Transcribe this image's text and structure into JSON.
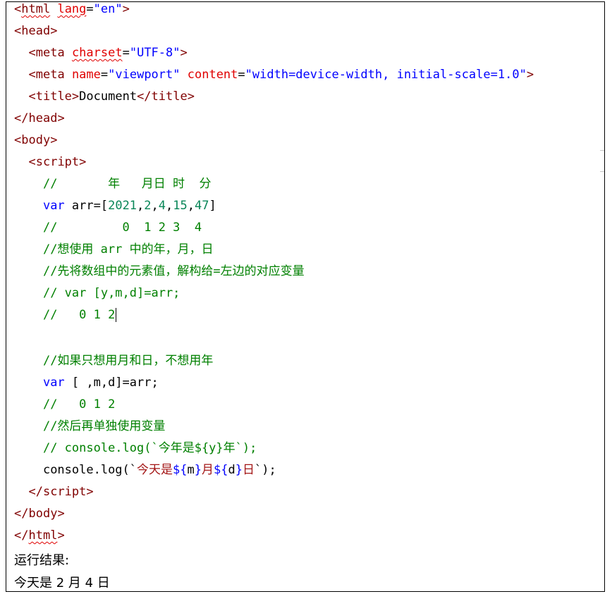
{
  "colors": {
    "tag_bracket": "#800000",
    "attribute": "#e00000",
    "attribute_value": "#0000ff",
    "keyword": "#0000ff",
    "comment": "#008000",
    "number": "#098658",
    "template_text": "#a31515",
    "plain": "#000000"
  },
  "code": {
    "l01": [
      "<",
      "html",
      " ",
      "lang",
      "=",
      "\"en\"",
      ">"
    ],
    "l02": [
      "<",
      "head",
      ">"
    ],
    "l03": [
      "  ",
      "<",
      "meta",
      " ",
      "charset",
      "=",
      "\"UTF-8\"",
      ">"
    ],
    "l04": [
      "  ",
      "<",
      "meta",
      " ",
      "name",
      "=",
      "\"viewport\"",
      " ",
      "content",
      "=",
      "\"width=device-width, initial-scale=1.0\"",
      ">"
    ],
    "l05": [
      "  ",
      "<",
      "title",
      ">",
      "Document",
      "</",
      "title",
      ">"
    ],
    "l06": [
      "</",
      "head",
      ">"
    ],
    "l07": [
      "<",
      "body",
      ">"
    ],
    "l08": [
      "  ",
      "<",
      "script",
      ">"
    ],
    "l09": [
      "    ",
      "//       年   月日 时  分"
    ],
    "l10": [
      "    ",
      "var",
      " arr=[",
      "2021",
      ",",
      "2",
      ",",
      "4",
      ",",
      "15",
      ",",
      "47",
      "]"
    ],
    "l11": [
      "    ",
      "//         0  1 2 3  4"
    ],
    "l12": [
      "    ",
      "//想使用 arr 中的年，月，日"
    ],
    "l13": [
      "    ",
      "//先将数组中的元素值，解构给=左边的对应变量"
    ],
    "l14": [
      "    ",
      "// var [y,m,d]=arr;"
    ],
    "l15": [
      "    ",
      "//   0 1 2"
    ],
    "l16": [
      "    ",
      "//如果只想用月和日，不想用年"
    ],
    "l17": [
      "    ",
      "var",
      " [ ,m,d]=arr;"
    ],
    "l18": [
      "    ",
      "//   0 1 2"
    ],
    "l19": [
      "    ",
      "//然后再单独使用变量"
    ],
    "l20": [
      "    ",
      "// console.log(`今年是${y}年`);"
    ],
    "l21": [
      "    ",
      "console.log(`",
      "今天是",
      "${",
      "m",
      "}",
      "月",
      "${",
      "d",
      "}",
      "日",
      "`);"
    ],
    "l22": [
      "  ",
      "</",
      "script",
      ">"
    ],
    "l23": [
      "</",
      "body",
      ">"
    ],
    "l24": [
      "</",
      "html",
      ">"
    ]
  },
  "result": {
    "label": "运行结果:",
    "output": "今天是 2 月 4 日"
  }
}
